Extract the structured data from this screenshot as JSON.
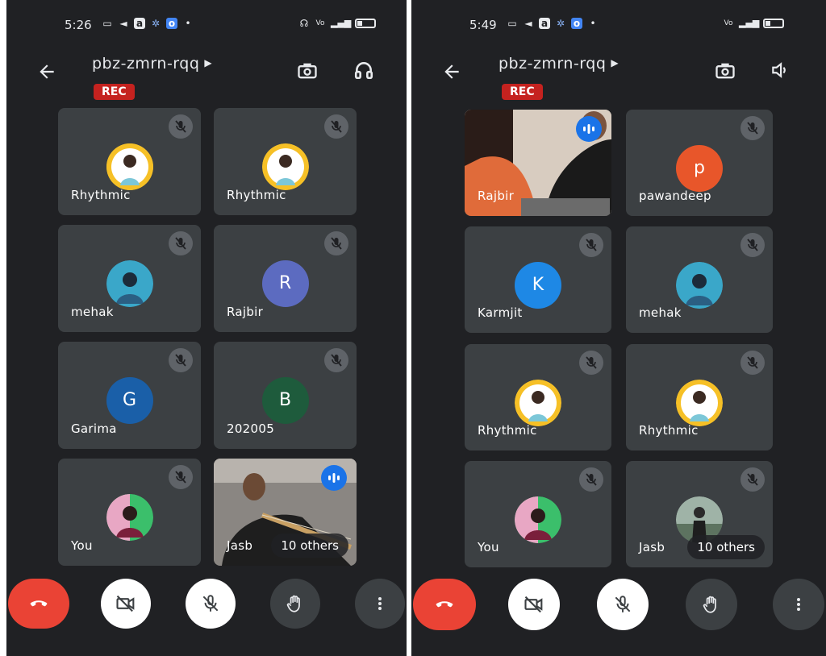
{
  "left": {
    "status": {
      "time": "5:26",
      "network": "⁰⁴ᴳ"
    },
    "meeting": {
      "title": "pbz-zmrn-rqq",
      "rec": "REC"
    },
    "tiles": [
      {
        "name": "Rhythmic",
        "avatar": ""
      },
      {
        "name": "Rhythmic",
        "avatar": ""
      },
      {
        "name": "mehak",
        "avatar": ""
      },
      {
        "name": "Rajbir",
        "avatar": "R",
        "color": "#5c6bc0"
      },
      {
        "name": "Garima",
        "avatar": "G",
        "color": "#1a5fa8"
      },
      {
        "name": "202005",
        "avatar": "B",
        "color": "#1e5b3c"
      },
      {
        "name": "You",
        "avatar": ""
      },
      {
        "name": "Jasb",
        "avatar": "",
        "others": "10 others"
      }
    ]
  },
  "right": {
    "status": {
      "time": "5:49",
      "network": "⁰⁴ᴳ"
    },
    "meeting": {
      "title": "pbz-zmrn-rqq",
      "rec": "REC"
    },
    "tiles": [
      {
        "name": "Rajbir",
        "avatar": ""
      },
      {
        "name": "pawandeep",
        "avatar": "p",
        "color": "#e8562a"
      },
      {
        "name": "Karmjit",
        "avatar": "K",
        "color": "#1e88e5"
      },
      {
        "name": "mehak",
        "avatar": ""
      },
      {
        "name": "Rhythmic",
        "avatar": ""
      },
      {
        "name": "Rhythmic",
        "avatar": ""
      },
      {
        "name": "You",
        "avatar": ""
      },
      {
        "name": "Jasb",
        "avatar": "",
        "others": "10 others"
      }
    ]
  },
  "colors": {
    "background": "#202124",
    "tile": "#3c4043",
    "rec": "#c5221f",
    "end_call": "#ea4335",
    "speaking": "#1a73e8"
  },
  "icons": {
    "back": "arrow-left-icon",
    "flip": "flip-camera-icon",
    "audio_left": "headphones-icon",
    "audio_right": "speaker-icon",
    "mute": "mic-off-icon",
    "end": "phone-hangup-icon",
    "camera": "camera-off-icon",
    "mic": "mic-off-icon",
    "hand": "raise-hand-icon",
    "more": "more-vertical-icon"
  }
}
